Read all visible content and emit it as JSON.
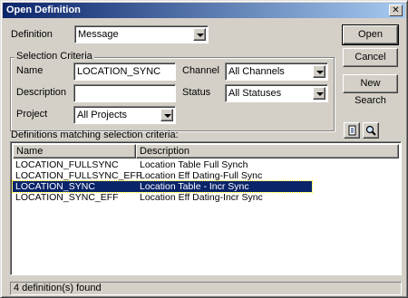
{
  "window": {
    "title": "Open Definition",
    "close_glyph": "✕"
  },
  "definition": {
    "label": "Definition",
    "value": "Message"
  },
  "criteria": {
    "group_title": "Selection Criteria",
    "name_label": "Name",
    "name_value": "LOCATION_SYNC",
    "description_label": "Description",
    "description_value": "",
    "project_label": "Project",
    "project_value": "All Projects",
    "channel_label": "Channel",
    "channel_value": "All Channels",
    "status_label": "Status",
    "status_value": "All Statuses"
  },
  "buttons": {
    "open": "Open",
    "cancel": "Cancel",
    "new_search": "New Search"
  },
  "icons": {
    "copy": "copy-icon",
    "search": "magnifier-icon"
  },
  "list": {
    "caption": "Definitions matching selection criteria:",
    "columns": [
      "Name",
      "Description"
    ],
    "rows": [
      {
        "name": "LOCATION_FULLSYNC",
        "description": "Location Table Full Synch",
        "selected": false
      },
      {
        "name": "LOCATION_FULLSYNC_EFF",
        "description": "Location  Eff Dating-Full Sync",
        "selected": false
      },
      {
        "name": "LOCATION_SYNC",
        "description": "Location Table - Incr Sync",
        "selected": true
      },
      {
        "name": "LOCATION_SYNC_EFF",
        "description": "Location  Eff Dating-Incr Sync",
        "selected": false
      }
    ]
  },
  "status": {
    "text": "4 definition(s) found"
  },
  "colors": {
    "titlebar_start": "#0a246a",
    "titlebar_end": "#a6caf0",
    "selection": "#0a246a",
    "face": "#d4d0c8"
  }
}
